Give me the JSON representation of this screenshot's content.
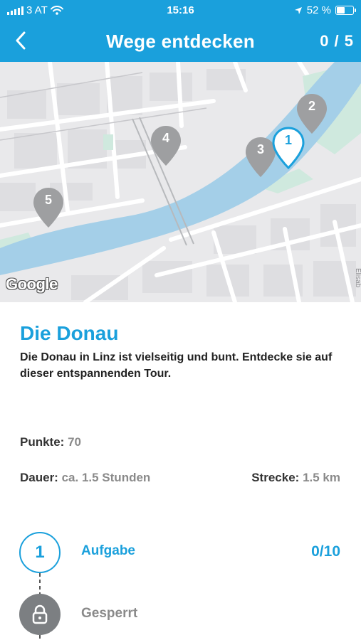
{
  "status_bar": {
    "carrier": "3 AT",
    "time": "15:16",
    "battery": "52 %",
    "battery_level": 0.52
  },
  "nav": {
    "title": "Wege entdecken",
    "progress": "0 / 5",
    "back_icon": "chevron-left-icon"
  },
  "map": {
    "attribution": "Google",
    "street_label": "Elisab",
    "markers": [
      {
        "label": "1",
        "active": true
      },
      {
        "label": "2",
        "active": false
      },
      {
        "label": "3",
        "active": false
      },
      {
        "label": "4",
        "active": false
      },
      {
        "label": "5",
        "active": false
      }
    ]
  },
  "tour": {
    "title": "Die Donau",
    "description": "Die Donau in Linz ist vielseitig und bunt. Entdecke sie auf dieser entspannenden Tour.",
    "points_label": "Punkte:",
    "points_value": "70",
    "duration_label": "Dauer:",
    "duration_value": "ca. 1.5 Stunden",
    "distance_label": "Strecke:",
    "distance_value": "1.5 km"
  },
  "steps": [
    {
      "number": "1",
      "label": "Aufgabe",
      "score": "0/10"
    },
    {
      "label": "Gesperrt",
      "icon": "lock-icon"
    }
  ],
  "colors": {
    "accent": "#1aa0dc",
    "river": "#a4cfe8",
    "park": "#cfe9de",
    "marker_inactive": "#9e9fa1"
  }
}
